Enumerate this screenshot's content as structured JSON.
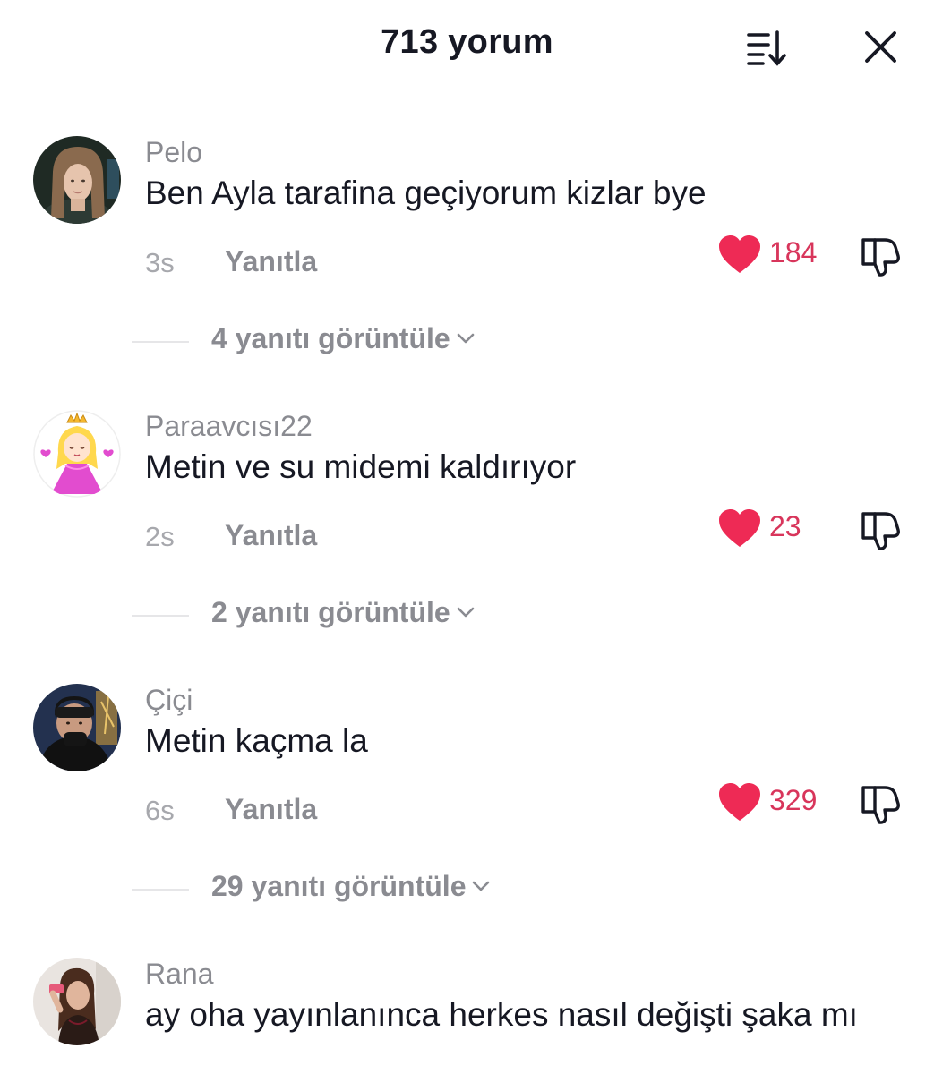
{
  "header": {
    "title": "713 yorum",
    "sort_icon": "sort-icon",
    "close_icon": "close-icon"
  },
  "colors": {
    "like": "#ee2a55",
    "like_count": "#d8355b",
    "muted": "#8a8b91",
    "text": "#161823"
  },
  "comments": [
    {
      "username": "Pelo",
      "text": "Ben Ayla tarafina geçiyorum kizlar bye",
      "time": "3s",
      "reply_label": "Yanıtla",
      "likes": "184",
      "replies_label": "4 yanıtı görüntüle"
    },
    {
      "username": "Paraavcısı22",
      "text": "Metin ve su midemi kaldırıyor",
      "time": "2s",
      "reply_label": "Yanıtla",
      "likes": "23",
      "replies_label": "2 yanıtı görüntüle"
    },
    {
      "username": "Çiçi",
      "text": "Metin kaçma la",
      "time": "6s",
      "reply_label": "Yanıtla",
      "likes": "329",
      "replies_label": "29 yanıtı görüntüle"
    },
    {
      "username": "Rana",
      "text": "ay oha yayınlanınca herkes nasıl değişti şaka mı"
    }
  ]
}
